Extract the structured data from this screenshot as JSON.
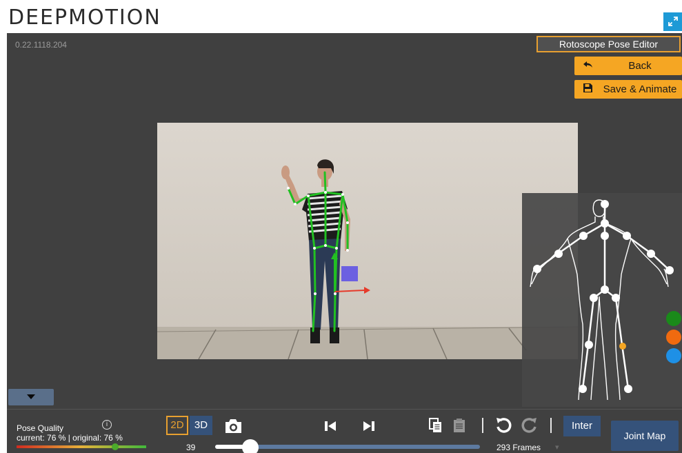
{
  "header": {
    "logo_text": "DEEPMOTION",
    "fullscreen_icon": "expand-arrows-icon"
  },
  "viewport": {
    "version": "0.22.1118.204",
    "editor_title": "Rotoscope Pose Editor",
    "back_label": "Back",
    "save_label": "Save & Animate"
  },
  "joint_panel": {
    "status_dots": [
      {
        "name": "green-status-dot",
        "color": "#1a8a1a"
      },
      {
        "name": "orange-status-dot",
        "color": "#f06a0f"
      },
      {
        "name": "blue-status-dot",
        "color": "#1e90e6"
      }
    ],
    "selected_joint_color": "#f5a623"
  },
  "bottombar": {
    "pose_quality_label": "Pose Quality",
    "pose_quality_values": "current:  76 % | original:  76 %",
    "pose_quality_fraction": 0.76,
    "btn_2d": "2D",
    "btn_3d": "3D",
    "inter_label": "Inter",
    "joint_map_label": "Joint Map",
    "current_frame": "39",
    "frames_total": "293  Frames",
    "timeline_fraction": 0.133
  },
  "colors": {
    "accent_orange": "#f5a623",
    "button_blue": "#35527a",
    "skeleton_green": "#22c022",
    "viewport_bg": "#404040"
  }
}
